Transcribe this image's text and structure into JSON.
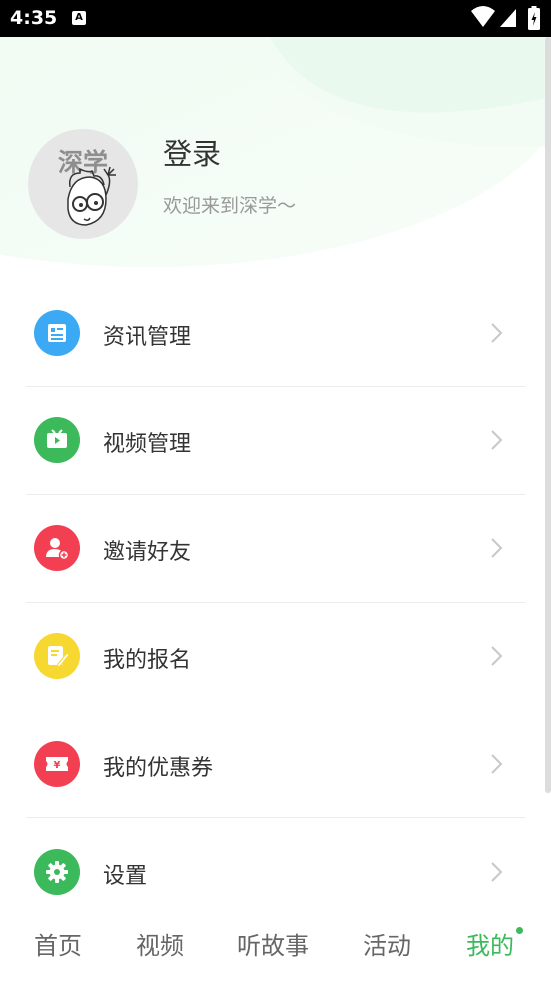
{
  "status_bar": {
    "time": "4:35",
    "notification_glyph": "A"
  },
  "profile": {
    "avatar_text": "深学",
    "login_label": "登录",
    "welcome_text": "欢迎来到深学～"
  },
  "menu": {
    "items": [
      {
        "label": "资讯管理",
        "icon": "news-icon",
        "color": "#3ba9f3"
      },
      {
        "label": "视频管理",
        "icon": "tv-icon",
        "color": "#3cb95b"
      },
      {
        "label": "邀请好友",
        "icon": "invite-user-icon",
        "color": "#f23f52"
      },
      {
        "label": "我的报名",
        "icon": "edit-note-icon",
        "color": "#f7d830"
      },
      {
        "label": "我的优惠券",
        "icon": "coupon-icon",
        "color": "#f23f52"
      },
      {
        "label": "设置",
        "icon": "gear-icon",
        "color": "#3cb95b"
      }
    ]
  },
  "tabs": {
    "items": [
      {
        "label": "首页"
      },
      {
        "label": "视频"
      },
      {
        "label": "听故事"
      },
      {
        "label": "活动"
      },
      {
        "label": "我的",
        "active": true
      }
    ]
  },
  "colors": {
    "accent": "#3cb95b",
    "header_tint": "#effbf1"
  }
}
